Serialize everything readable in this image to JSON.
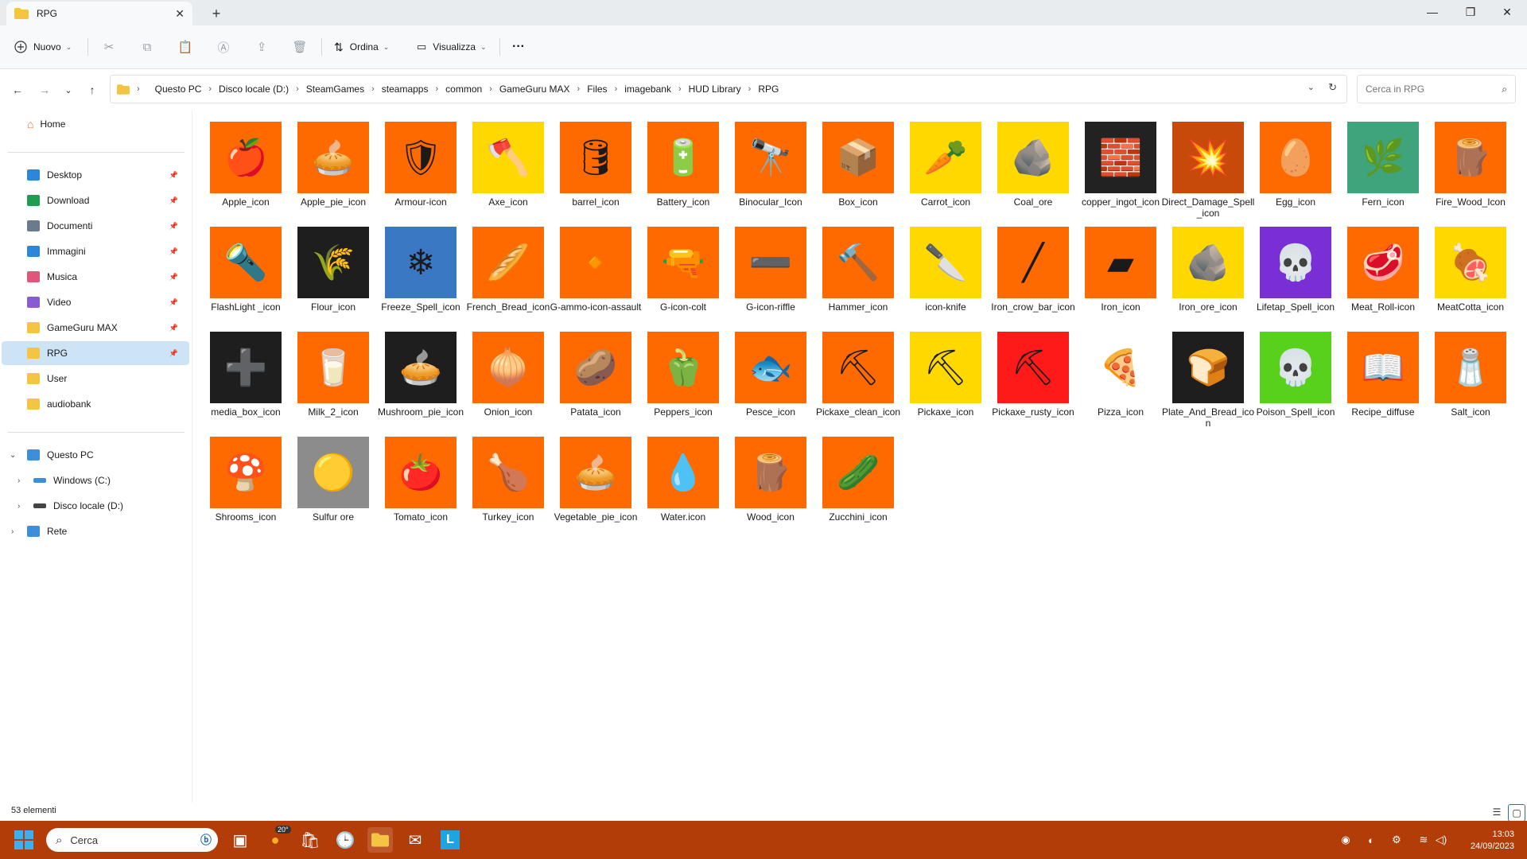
{
  "window": {
    "tab_title": "RPG",
    "tab_close": "✕",
    "new_tab": "+",
    "minimize": "—",
    "maximize": "❐",
    "close": "✕"
  },
  "toolbar": {
    "new_label": "Nuovo",
    "sort_label": "Ordina",
    "view_label": "Visualizza",
    "more_label": "···"
  },
  "address": {
    "crumbs": [
      "Questo PC",
      "Disco locale (D:)",
      "SteamGames",
      "steamapps",
      "common",
      "GameGuru MAX",
      "Files",
      "imagebank",
      "HUD Library",
      "RPG"
    ],
    "search_placeholder": "Cerca in RPG"
  },
  "sidebar": {
    "home": "Home",
    "quick": [
      {
        "label": "Desktop",
        "icon": "desktop-icon",
        "color": "#2b88d8"
      },
      {
        "label": "Download",
        "icon": "download-icon",
        "color": "#1f9d55"
      },
      {
        "label": "Documenti",
        "icon": "document-icon",
        "color": "#6b7b8c"
      },
      {
        "label": "Immagini",
        "icon": "pictures-icon",
        "color": "#2b88d8"
      },
      {
        "label": "Musica",
        "icon": "music-icon",
        "color": "#e0567a"
      },
      {
        "label": "Video",
        "icon": "video-icon",
        "color": "#8a5cd1"
      },
      {
        "label": "GameGuru MAX",
        "icon": "folder-icon",
        "color": "#f4c542"
      },
      {
        "label": "RPG",
        "icon": "folder-icon",
        "color": "#f4c542"
      }
    ],
    "folders": [
      {
        "label": "User",
        "icon": "folder-icon",
        "color": "#f4c542"
      },
      {
        "label": "audiobank",
        "icon": "folder-icon",
        "color": "#f4c542"
      }
    ],
    "this_pc": "Questo PC",
    "drives": [
      {
        "label": "Windows (C:)",
        "icon": "windows-drive-icon"
      },
      {
        "label": "Disco locale (D:)",
        "icon": "drive-icon"
      }
    ],
    "network": "Rete"
  },
  "files": [
    {
      "name": "Apple_icon",
      "bg": "#ff6a00",
      "glyph": "🍎"
    },
    {
      "name": "Apple_pie_icon",
      "bg": "#ff6a00",
      "glyph": "🥧"
    },
    {
      "name": "Armour-icon",
      "bg": "#ff6a00",
      "glyph": "🛡"
    },
    {
      "name": "Axe_icon",
      "bg": "#ffd800",
      "glyph": "🪓"
    },
    {
      "name": "barrel_icon",
      "bg": "#ff6a00",
      "glyph": "🛢"
    },
    {
      "name": "Battery_icon",
      "bg": "#ff6a00",
      "glyph": "🔋"
    },
    {
      "name": "Binocular_Icon",
      "bg": "#ff6a00",
      "glyph": "🔭"
    },
    {
      "name": "Box_icon",
      "bg": "#ff6a00",
      "glyph": "📦"
    },
    {
      "name": "Carrot_icon",
      "bg": "#ffd800",
      "glyph": "🥕"
    },
    {
      "name": "Coal_ore",
      "bg": "#ffd800",
      "glyph": "🪨"
    },
    {
      "name": "copper_ingot_icon",
      "bg": "#222222",
      "glyph": "🧱"
    },
    {
      "name": "Direct_Damage_Spell_icon",
      "bg": "#c84a0a",
      "glyph": "💥"
    },
    {
      "name": "Egg_icon",
      "bg": "#ff6a00",
      "glyph": "🥚"
    },
    {
      "name": "Fern_icon",
      "bg": "#3fa37c",
      "glyph": "🌿"
    },
    {
      "name": "Fire_Wood_Icon",
      "bg": "#ff6a00",
      "glyph": "🪵"
    },
    {
      "name": "FlashLight _icon",
      "bg": "#ff6a00",
      "glyph": "🔦"
    },
    {
      "name": "Flour_icon",
      "bg": "#1e1e1e",
      "glyph": "🌾"
    },
    {
      "name": "Freeze_Spell_icon",
      "bg": "#3b78c4",
      "glyph": "❄"
    },
    {
      "name": "French_Bread_icon",
      "bg": "#ff6a00",
      "glyph": "🥖"
    },
    {
      "name": "G-ammo-icon-assault",
      "bg": "#ff6a00",
      "glyph": "🔸"
    },
    {
      "name": "G-icon-colt",
      "bg": "#ff6a00",
      "glyph": "🔫"
    },
    {
      "name": "G-icon-riffle",
      "bg": "#ff6a00",
      "glyph": "➖"
    },
    {
      "name": "Hammer_icon",
      "bg": "#ff6a00",
      "glyph": "🔨"
    },
    {
      "name": "icon-knife",
      "bg": "#ffd800",
      "glyph": "🔪"
    },
    {
      "name": "Iron_crow_bar_icon",
      "bg": "#ff6a00",
      "glyph": "╱"
    },
    {
      "name": "Iron_icon",
      "bg": "#ff6a00",
      "glyph": "▰"
    },
    {
      "name": "Iron_ore_icon",
      "bg": "#ffd800",
      "glyph": "🪨"
    },
    {
      "name": "Lifetap_Spell_icon",
      "bg": "#7a2fd6",
      "glyph": "💀"
    },
    {
      "name": "Meat_Roll-icon",
      "bg": "#ff6a00",
      "glyph": "🥩"
    },
    {
      "name": "MeatCotta_icon",
      "bg": "#ffd800",
      "glyph": "🍖"
    },
    {
      "name": "media_box_icon",
      "bg": "#1e1e1e",
      "glyph": "➕"
    },
    {
      "name": "Milk_2_icon",
      "bg": "#ff6a00",
      "glyph": "🥛"
    },
    {
      "name": "Mushroom_pie_icon",
      "bg": "#1e1e1e",
      "glyph": "🥧"
    },
    {
      "name": "Onion_icon",
      "bg": "#ff6a00",
      "glyph": "🧅"
    },
    {
      "name": "Patata_icon",
      "bg": "#ff6a00",
      "glyph": "🥔"
    },
    {
      "name": "Peppers_icon",
      "bg": "#ff6a00",
      "glyph": "🫑"
    },
    {
      "name": "Pesce_icon",
      "bg": "#ff6a00",
      "glyph": "🐟"
    },
    {
      "name": "Pickaxe_clean_icon",
      "bg": "#ff6a00",
      "glyph": "⛏"
    },
    {
      "name": "Pickaxe_icon",
      "bg": "#ffd800",
      "glyph": "⛏"
    },
    {
      "name": "Pickaxe_rusty_icon",
      "bg": "#ff1a1a",
      "glyph": "⛏"
    },
    {
      "name": "Pizza_icon",
      "bg": "#ffffff",
      "glyph": "🍕"
    },
    {
      "name": "Plate_And_Bread_icon",
      "bg": "#1e1e1e",
      "glyph": "🍞"
    },
    {
      "name": "Poison_Spell_icon",
      "bg": "#58d11d",
      "glyph": "💀"
    },
    {
      "name": "Recipe_diffuse",
      "bg": "#ff6a00",
      "glyph": "📖"
    },
    {
      "name": "Salt_icon",
      "bg": "#ff6a00",
      "glyph": "🧂"
    },
    {
      "name": "Shrooms_icon",
      "bg": "#ff6a00",
      "glyph": "🍄"
    },
    {
      "name": "Sulfur ore",
      "bg": "#8c8c8c",
      "glyph": "🟡"
    },
    {
      "name": "Tomato_icon",
      "bg": "#ff6a00",
      "glyph": "🍅"
    },
    {
      "name": "Turkey_icon",
      "bg": "#ff6a00",
      "glyph": "🍗"
    },
    {
      "name": "Vegetable_pie_icon",
      "bg": "#ff6a00",
      "glyph": "🥧"
    },
    {
      "name": "Water.icon",
      "bg": "#ff6a00",
      "glyph": "💧"
    },
    {
      "name": "Wood_icon",
      "bg": "#ff6a00",
      "glyph": "🪵"
    },
    {
      "name": "Zucchini_icon",
      "bg": "#ff6a00",
      "glyph": "🥒"
    }
  ],
  "status": {
    "count": "53 elementi"
  },
  "taskbar": {
    "search_label": "Cerca",
    "weather": "20°",
    "time": "13:03",
    "date": "24/09/2023",
    "accent": "#b23d08"
  }
}
